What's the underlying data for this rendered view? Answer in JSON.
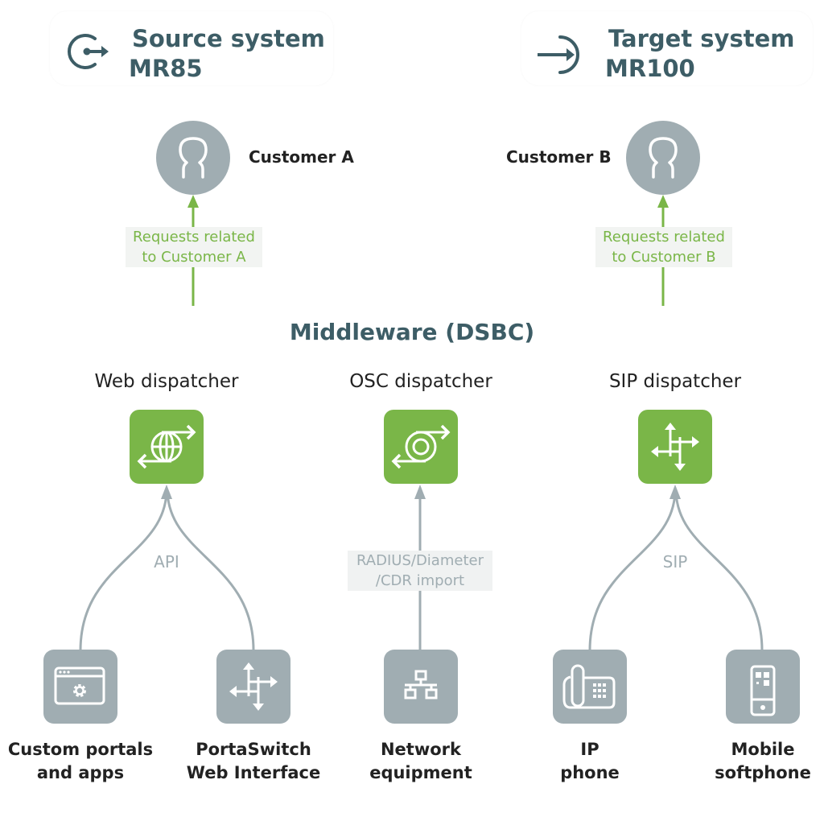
{
  "source_system": {
    "title": "Source system",
    "version": "MR85",
    "icon": "sign-out-icon"
  },
  "target_system": {
    "title": "Target system",
    "version": "MR100",
    "icon": "sign-in-icon"
  },
  "customers": [
    {
      "label": "Customer A",
      "request_line1": "Requests related",
      "request_line2": "to Customer A",
      "icon": "user-icon"
    },
    {
      "label": "Customer B",
      "request_line1": "Requests related",
      "request_line2": "to Customer B",
      "icon": "user-icon"
    }
  ],
  "middleware": {
    "title": "Middleware (DSBC)"
  },
  "dispatchers": [
    {
      "label": "Web dispatcher",
      "icon": "globe-exchange-icon"
    },
    {
      "label": "OSC dispatcher",
      "icon": "circle-exchange-icon"
    },
    {
      "label": "SIP dispatcher",
      "icon": "four-way-arrows-icon"
    }
  ],
  "edges": {
    "web": "API",
    "osc_line1": "RADIUS/Diameter",
    "osc_line2": "/CDR import",
    "sip": "SIP"
  },
  "devices": [
    {
      "line1": "Custom portals",
      "line2": "and apps",
      "icon": "browser-gear-icon"
    },
    {
      "line1": "PortaSwitch",
      "line2": "Web Interface",
      "icon": "four-way-arrows-icon"
    },
    {
      "line1": "Network",
      "line2": "equipment",
      "icon": "network-icon"
    },
    {
      "line1": "IP",
      "line2": "phone",
      "icon": "desk-phone-icon"
    },
    {
      "line1": "Mobile",
      "line2": "softphone",
      "icon": "mobile-phone-icon"
    }
  ],
  "colors": {
    "heading": "#3d5d66",
    "accent_green": "#7ab648",
    "node_grey": "#a0adb2",
    "text_dark": "#222222"
  }
}
